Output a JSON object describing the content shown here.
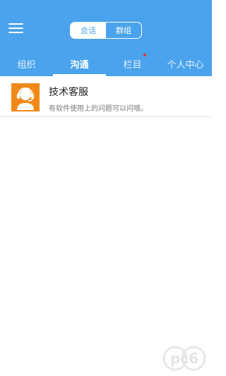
{
  "header": {
    "segmented": {
      "items": [
        "会话",
        "群组"
      ],
      "active_index": 0
    }
  },
  "tabs": [
    {
      "label": "组织"
    },
    {
      "label": "沟通"
    },
    {
      "label": "栏目"
    },
    {
      "label": "个人中心"
    }
  ],
  "active_tab_index": 1,
  "conversations": [
    {
      "title": "技术客服",
      "subtitle": "有软件使用上的问题可以问哦。",
      "avatar_icon": "customer-service-headset-icon"
    }
  ],
  "watermark": {
    "text": "pc6"
  },
  "colors": {
    "header_bg": "#4aa3ec",
    "avatar_bg": "#f0891a",
    "badge_dot": "#e8352e"
  }
}
